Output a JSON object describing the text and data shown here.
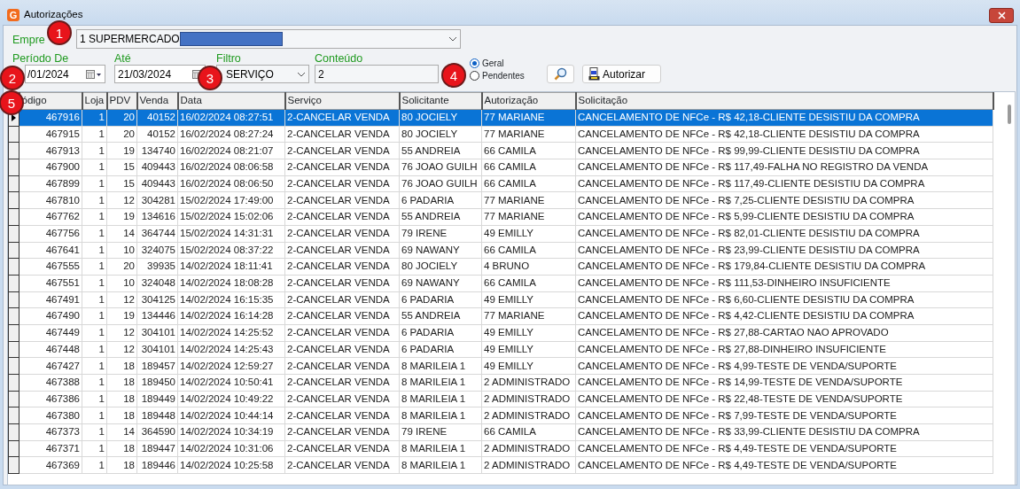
{
  "window": {
    "title": "Autorizações",
    "icon_letter": "G"
  },
  "callouts": [
    "1",
    "2",
    "3",
    "4",
    "5"
  ],
  "empresa": {
    "label": "Empre",
    "value": "1 SUPERMERCADO"
  },
  "periodo_de": {
    "label": "Período De",
    "value": "/01/2024"
  },
  "ate": {
    "label": "Até",
    "value": "21/03/2024"
  },
  "filtro": {
    "label": "Filtro",
    "value": "SERVIÇO"
  },
  "conteudo": {
    "label": "Conteúdo",
    "value": "2"
  },
  "radios": [
    {
      "label": "Geral",
      "selected": true
    },
    {
      "label": "Pendentes",
      "selected": false
    }
  ],
  "autorizar_button": {
    "label": "Autorizar"
  },
  "table": {
    "columns": [
      "ódigo",
      "Loja",
      "PDV",
      "Venda",
      "Data",
      "Serviço",
      "Solicitante",
      "Autorização",
      "Solicitação"
    ],
    "rows": [
      {
        "selected": true,
        "cells": [
          "467916",
          "1",
          "20",
          "40152",
          "16/02/2024 08:27:51",
          "2-CANCELAR VENDA",
          "80 JOCIELY",
          "77 MARIANE",
          "CANCELAMENTO DE NFCe - R$ 42,18-CLIENTE DESISTIU DA COMPRA"
        ]
      },
      {
        "selected": false,
        "cells": [
          "467915",
          "1",
          "20",
          "40152",
          "16/02/2024 08:27:24",
          "2-CANCELAR VENDA",
          "80 JOCIELY",
          "77 MARIANE",
          "CANCELAMENTO DE NFCe - R$ 42,18-CLIENTE DESISTIU DA COMPRA"
        ]
      },
      {
        "selected": false,
        "cells": [
          "467913",
          "1",
          "19",
          "134740",
          "16/02/2024 08:21:07",
          "2-CANCELAR VENDA",
          "55 ANDREIA",
          "66 CAMILA",
          "CANCELAMENTO DE NFCe - R$ 99,99-CLIENTE DESISTIU DA COMPRA"
        ]
      },
      {
        "selected": false,
        "cells": [
          "467900",
          "1",
          "15",
          "409443",
          "16/02/2024 08:06:58",
          "2-CANCELAR VENDA",
          "76 JOAO GUILH",
          "66 CAMILA",
          "CANCELAMENTO DE NFCe - R$ 117,49-FALHA NO REGISTRO DA VENDA"
        ]
      },
      {
        "selected": false,
        "cells": [
          "467899",
          "1",
          "15",
          "409443",
          "16/02/2024 08:06:50",
          "2-CANCELAR VENDA",
          "76 JOAO GUILH",
          "66 CAMILA",
          "CANCELAMENTO DE NFCe - R$ 117,49-CLIENTE DESISTIU DA COMPRA"
        ]
      },
      {
        "selected": false,
        "cells": [
          "467810",
          "1",
          "12",
          "304281",
          "15/02/2024 17:49:00",
          "2-CANCELAR VENDA",
          "6 PADARIA",
          "77 MARIANE",
          "CANCELAMENTO DE NFCe - R$ 7,25-CLIENTE DESISTIU DA COMPRA"
        ]
      },
      {
        "selected": false,
        "cells": [
          "467762",
          "1",
          "19",
          "134616",
          "15/02/2024 15:02:06",
          "2-CANCELAR VENDA",
          "55 ANDREIA",
          "77 MARIANE",
          "CANCELAMENTO DE NFCe - R$ 5,99-CLIENTE DESISTIU DA COMPRA"
        ]
      },
      {
        "selected": false,
        "cells": [
          "467756",
          "1",
          "14",
          "364744",
          "15/02/2024 14:31:31",
          "2-CANCELAR VENDA",
          "79 IRENE",
          "49 EMILLY",
          "CANCELAMENTO DE NFCe - R$ 82,01-CLIENTE DESISTIU DA COMPRA"
        ]
      },
      {
        "selected": false,
        "cells": [
          "467641",
          "1",
          "10",
          "324075",
          "15/02/2024 08:37:22",
          "2-CANCELAR VENDA",
          "69 NAWANY",
          "66 CAMILA",
          "CANCELAMENTO DE NFCe - R$ 23,99-CLIENTE DESISTIU DA COMPRA"
        ]
      },
      {
        "selected": false,
        "cells": [
          "467555",
          "1",
          "20",
          "39935",
          "14/02/2024 18:11:41",
          "2-CANCELAR VENDA",
          "80 JOCIELY",
          "4 BRUNO",
          "CANCELAMENTO DE NFCe - R$ 179,84-CLIENTE DESISTIU DA COMPRA"
        ]
      },
      {
        "selected": false,
        "cells": [
          "467551",
          "1",
          "10",
          "324048",
          "14/02/2024 18:08:28",
          "2-CANCELAR VENDA",
          "69 NAWANY",
          "66 CAMILA",
          "CANCELAMENTO DE NFCe - R$ 111,53-DINHEIRO INSUFICIENTE"
        ]
      },
      {
        "selected": false,
        "cells": [
          "467491",
          "1",
          "12",
          "304125",
          "14/02/2024 16:15:35",
          "2-CANCELAR VENDA",
          "6 PADARIA",
          "49 EMILLY",
          "CANCELAMENTO DE NFCe - R$ 6,60-CLIENTE DESISTIU DA COMPRA"
        ]
      },
      {
        "selected": false,
        "cells": [
          "467490",
          "1",
          "19",
          "134446",
          "14/02/2024 16:14:28",
          "2-CANCELAR VENDA",
          "55 ANDREIA",
          "77 MARIANE",
          "CANCELAMENTO DE NFCe - R$ 4,42-CLIENTE DESISTIU DA COMPRA"
        ]
      },
      {
        "selected": false,
        "cells": [
          "467449",
          "1",
          "12",
          "304101",
          "14/02/2024 14:25:52",
          "2-CANCELAR VENDA",
          "6 PADARIA",
          "49 EMILLY",
          "CANCELAMENTO DE NFCe - R$ 27,88-CARTAO NAO APROVADO"
        ]
      },
      {
        "selected": false,
        "cells": [
          "467448",
          "1",
          "12",
          "304101",
          "14/02/2024 14:25:43",
          "2-CANCELAR VENDA",
          "6 PADARIA",
          "49 EMILLY",
          "CANCELAMENTO DE NFCe - R$ 27,88-DINHEIRO INSUFICIENTE"
        ]
      },
      {
        "selected": false,
        "cells": [
          "467427",
          "1",
          "18",
          "189457",
          "14/02/2024 12:59:27",
          "2-CANCELAR VENDA",
          "8 MARILEIA 1",
          "49 EMILLY",
          "CANCELAMENTO DE NFCe - R$ 4,99-TESTE DE VENDA/SUPORTE"
        ]
      },
      {
        "selected": false,
        "cells": [
          "467388",
          "1",
          "18",
          "189450",
          "14/02/2024 10:50:41",
          "2-CANCELAR VENDA",
          "8 MARILEIA 1",
          "2 ADMINISTRADO",
          "CANCELAMENTO DE NFCe - R$ 14,99-TESTE DE VENDA/SUPORTE"
        ]
      },
      {
        "selected": false,
        "cells": [
          "467386",
          "1",
          "18",
          "189449",
          "14/02/2024 10:49:22",
          "2-CANCELAR VENDA",
          "8 MARILEIA 1",
          "2 ADMINISTRADO",
          "CANCELAMENTO DE NFCe - R$ 22,48-TESTE DE VENDA/SUPORTE"
        ]
      },
      {
        "selected": false,
        "cells": [
          "467380",
          "1",
          "18",
          "189448",
          "14/02/2024 10:44:14",
          "2-CANCELAR VENDA",
          "8 MARILEIA 1",
          "2 ADMINISTRADO",
          "CANCELAMENTO DE NFCe - R$ 7,99-TESTE DE VENDA/SUPORTE"
        ]
      },
      {
        "selected": false,
        "cells": [
          "467373",
          "1",
          "14",
          "364590",
          "14/02/2024 10:34:19",
          "2-CANCELAR VENDA",
          "79 IRENE",
          "66 CAMILA",
          "CANCELAMENTO DE NFCe - R$ 33,99-CLIENTE DESISTIU DA COMPRA"
        ]
      },
      {
        "selected": false,
        "cells": [
          "467371",
          "1",
          "18",
          "189447",
          "14/02/2024 10:31:06",
          "2-CANCELAR VENDA",
          "8 MARILEIA 1",
          "2 ADMINISTRADO",
          "CANCELAMENTO DE NFCe - R$ 4,49-TESTE DE VENDA/SUPORTE"
        ]
      },
      {
        "selected": false,
        "cells": [
          "467369",
          "1",
          "18",
          "189446",
          "14/02/2024 10:25:58",
          "2-CANCELAR VENDA",
          "8 MARILEIA 1",
          "2 ADMINISTRADO",
          "CANCELAMENTO DE NFCe - R$ 4,49-TESTE DE VENDA/SUPORTE"
        ]
      }
    ]
  }
}
